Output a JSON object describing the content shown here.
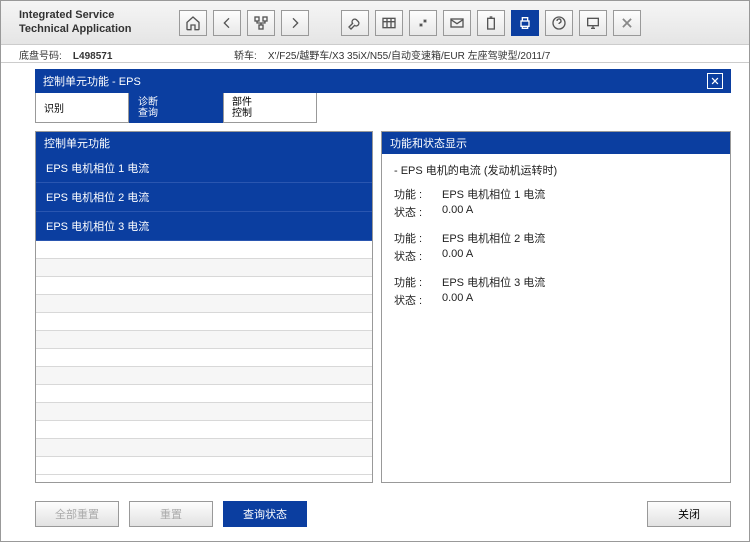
{
  "app": {
    "title_line1": "Integrated Service",
    "title_line2": "Technical Application"
  },
  "infobar": {
    "chassis_label": "底盘号码:",
    "chassis_value": "L498571",
    "vehicle_label": "轿车:",
    "vehicle_value": "X'/F25/越野车/X3 35iX/N55/自动变速箱/EUR 左座驾驶型/2011/7"
  },
  "panel": {
    "title": "控制单元功能 - EPS"
  },
  "tabs": [
    {
      "label": "识别",
      "active": false
    },
    {
      "label": "诊断\n查询",
      "active": true
    },
    {
      "label": "部件\n控制",
      "active": false
    }
  ],
  "left_panel": {
    "header": "控制单元功能",
    "items": [
      "EPS 电机相位 1 电流",
      "EPS 电机相位 2 电流",
      "EPS 电机相位 3 电流"
    ]
  },
  "right_panel": {
    "header": "功能和状态显示",
    "title": "- EPS 电机的电流 (发动机运转时)",
    "func_label": "功能 :",
    "state_label": "状态 :",
    "blocks": [
      {
        "func": "EPS 电机相位 1 电流",
        "state": "0.00 A"
      },
      {
        "func": "EPS 电机相位 2 电流",
        "state": "0.00 A"
      },
      {
        "func": "EPS 电机相位 3 电流",
        "state": "0.00 A"
      }
    ]
  },
  "footer": {
    "reset_all": "全部重置",
    "reset": "重置",
    "query_status": "查询状态",
    "close": "关闭"
  }
}
